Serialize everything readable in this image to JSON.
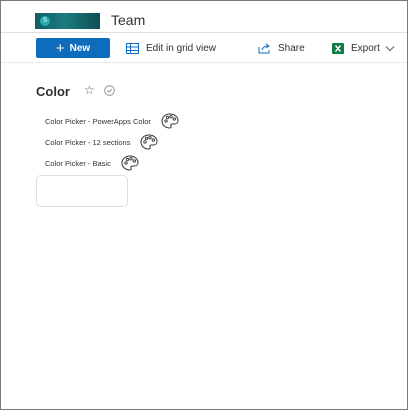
{
  "site": {
    "title": "Team"
  },
  "command_bar": {
    "new_label": "New",
    "edit_grid_label": "Edit in grid view",
    "share_label": "Share",
    "export_label": "Export"
  },
  "list": {
    "title": "Color",
    "links": [
      {
        "label": "Color Picker - PowerApps Color"
      },
      {
        "label": "Color Picker - 12 sections"
      },
      {
        "label": "Color Picker - Basic"
      }
    ]
  },
  "colors": {
    "accent": "#0f6cbd",
    "export_icon": "#107c41",
    "logo": "#0e5f63"
  }
}
